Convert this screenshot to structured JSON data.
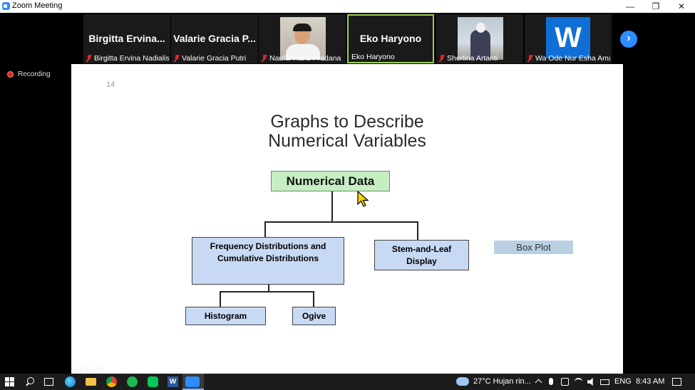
{
  "window": {
    "title": "Zoom Meeting",
    "minimize_glyph": "—",
    "restore_glyph": "❐",
    "close_glyph": "✕"
  },
  "participants": [
    {
      "display": "Birgitta  Ervina...",
      "caption": "Birgitta Ervina Nadialis...",
      "muted": true,
      "video": "off"
    },
    {
      "display": "Valarie  Gracia  P...",
      "caption": "Valarie Gracia Putri",
      "muted": true,
      "video": "off"
    },
    {
      "display": "",
      "caption": "Naufal Haris Pradana",
      "muted": true,
      "video": "on"
    },
    {
      "display": "Eko Haryono",
      "caption": "Eko Haryono",
      "muted": false,
      "video": "off",
      "active_speaker": true
    },
    {
      "display": "",
      "caption": "Sherlina Artanti",
      "muted": true,
      "video": "on"
    },
    {
      "display": "W",
      "caption": "Wa Ode Nur Esha Ama...",
      "muted": true,
      "video": "avatar"
    }
  ],
  "recording": {
    "label": "Recording"
  },
  "slide": {
    "page_number": "14",
    "title_line1": "Graphs to Describe",
    "title_line2": "Numerical Variables",
    "root": "Numerical Data",
    "freq_line1": "Frequency Distributions and",
    "freq_line2": "Cumulative Distributions",
    "stem_line1": "Stem-and-Leaf",
    "stem_line2": "Display",
    "histogram": "Histogram",
    "ogive": "Ogive",
    "boxplot": "Box Plot"
  },
  "taskbar": {
    "weather": "27°C  Hujan rin...",
    "language": "ENG",
    "time": "8:43 AM"
  },
  "colors": {
    "zoom_blue": "#2d8cff",
    "active_speaker": "#9ad14b",
    "root_box": "#c6eec2",
    "child_box": "#c8d9f4",
    "boxplot_box": "#b9d0e2",
    "mute_red": "#e02828"
  }
}
